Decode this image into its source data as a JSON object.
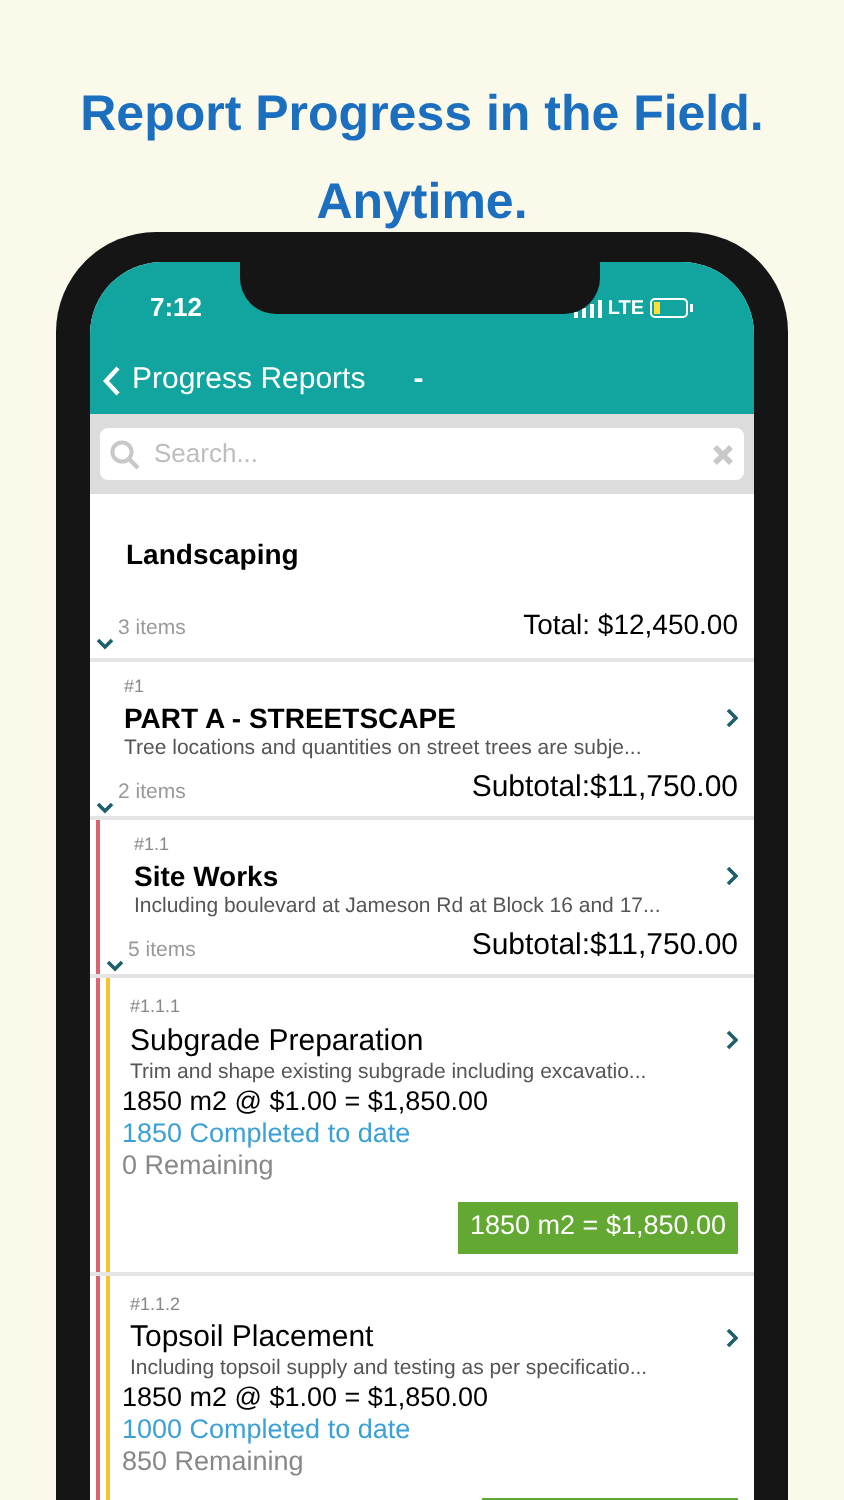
{
  "headline": [
    "Report Progress in the Field.",
    "Anytime."
  ],
  "status_bar": {
    "time": "7:12",
    "network": "LTE",
    "battery_low": true
  },
  "nav": {
    "back_label": "Progress Reports",
    "title": "-"
  },
  "search": {
    "placeholder": "Search..."
  },
  "tree": {
    "title": "Landscaping",
    "count": "3 items",
    "total": "Total: $12,450.00",
    "expanded": true,
    "children": [
      {
        "number": "#1",
        "title": "PART A - STREETSCAPE",
        "description": "Tree locations and quantities on street trees are subje...",
        "count": "2 items",
        "total": "Subtotal:$11,750.00",
        "expanded": true,
        "children": [
          {
            "number": "#1.1",
            "title": "Site Works",
            "description": "Including boulevard at Jameson Rd at Block 16 and 17...",
            "count": "5 items",
            "total": "Subtotal:$11,750.00",
            "expanded": true,
            "color": "#d9646e",
            "children": [
              {
                "number": "#1.1.1",
                "title": "Subgrade Preparation",
                "description": "Trim and shape existing subgrade including excavatio...",
                "quantity": "1850 m2 @ $1.00 = $1,850.00",
                "completed": "1850 Completed to date",
                "remaining": "0 Remaining",
                "amount_button": "1850 m2 = $1,850.00",
                "color": "#f5c531"
              },
              {
                "number": "#1.1.2",
                "title": "Topsoil Placement",
                "description": "Including topsoil supply and testing as per specificatio...",
                "quantity": "1850 m2 @ $1.00 = $1,850.00",
                "completed": "1000 Completed to date",
                "remaining": "850 Remaining",
                "amount_button": true,
                "color": "#f5c531"
              }
            ]
          }
        ]
      }
    ]
  }
}
